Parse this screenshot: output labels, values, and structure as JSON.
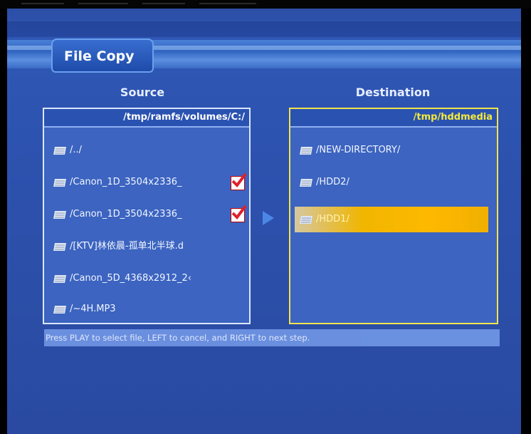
{
  "window": {
    "title": "File Copy"
  },
  "columns": {
    "source": "Source",
    "destination": "Destination"
  },
  "source": {
    "path": "/tmp/ramfs/volumes/C:/",
    "items": [
      {
        "label": "/../",
        "checked": false
      },
      {
        "label": "/Canon_1D_3504x2336_",
        "checked": true
      },
      {
        "label": "/Canon_1D_3504x2336_",
        "checked": true
      },
      {
        "label": "/[KTV]林依晨-孤单北半球.d",
        "checked": false
      },
      {
        "label": "/Canon_5D_4368x2912_2‹",
        "checked": false
      },
      {
        "label": "/~4H.MP3",
        "checked": false
      }
    ]
  },
  "destination": {
    "path": "/tmp/hddmedia",
    "items": [
      {
        "label": "/NEW-DIRECTORY/",
        "selected": false
      },
      {
        "label": "/HDD2/",
        "selected": false
      },
      {
        "label": "/HDD1/",
        "selected": true
      }
    ]
  },
  "status": {
    "text": "Press PLAY to select file, LEFT to cancel, and RIGHT to next step."
  },
  "colors": {
    "background": "#2f57b5",
    "highlight": "#ffb800",
    "destination_border": "#f2e34c",
    "checkmark": "#e0202a"
  },
  "icons": {
    "item": "folder-icon",
    "check": "checkbox-checked-icon",
    "arrow": "right-arrow-icon"
  }
}
